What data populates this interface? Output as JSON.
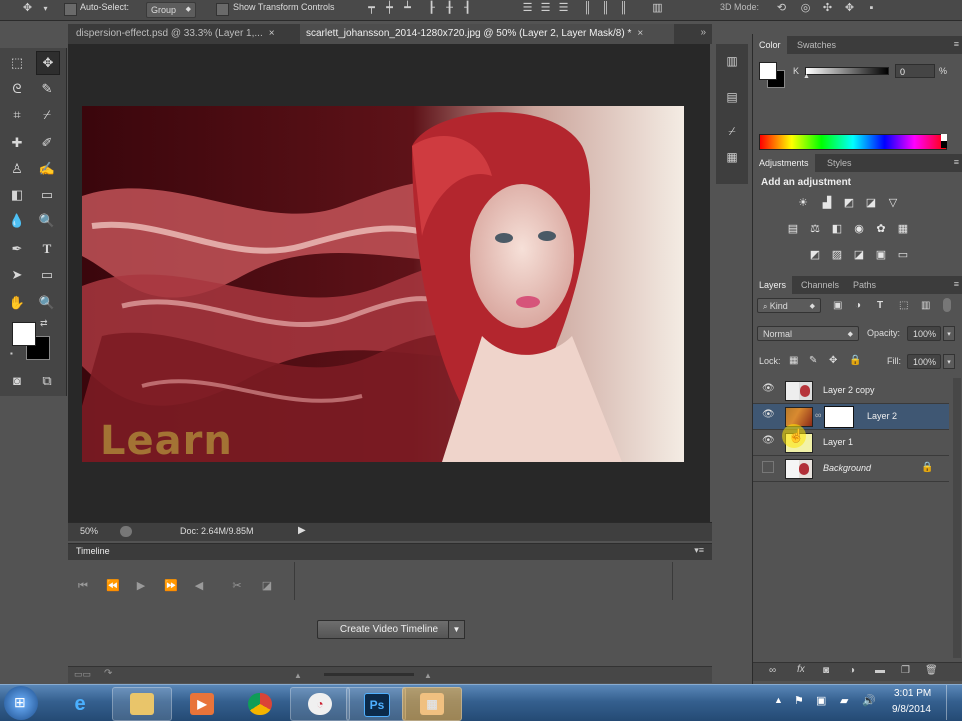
{
  "options_bar": {
    "auto_select_label": "Auto-Select:",
    "auto_select_value": "Group",
    "show_transform_label": "Show Transform Controls",
    "mode_3d_label": "3D Mode:"
  },
  "document_tabs": [
    {
      "label": "dispersion-effect.psd @ 33.3% (Layer 1,...",
      "close": "×"
    },
    {
      "label": "scarlett_johansson_2014-1280x720.jpg @ 50% (Layer 2, Layer Mask/8) *",
      "close": "×"
    }
  ],
  "watermark": "Learn",
  "status": {
    "zoom": "50%",
    "doc": "Doc: 2.64M/9.85M"
  },
  "timeline": {
    "title": "Timeline",
    "create_button": "Create Video Timeline"
  },
  "color_panel": {
    "tabs": [
      "Color",
      "Swatches"
    ],
    "k_label": "K",
    "k_value": "0",
    "k_unit": "%"
  },
  "adjustments_panel": {
    "tabs": [
      "Adjustments",
      "Styles"
    ],
    "heading": "Add an adjustment",
    "row1_icons": [
      "brightness-contrast-icon",
      "levels-icon",
      "curves-icon",
      "exposure-icon",
      "vibrance-icon"
    ],
    "row2_icons": [
      "hue-saturation-icon",
      "color-balance-icon",
      "black-white-icon",
      "photo-filter-icon",
      "channel-mixer-icon",
      "color-lookup-icon"
    ],
    "row3_icons": [
      "invert-icon",
      "posterize-icon",
      "threshold-icon",
      "selective-color-icon",
      "gradient-map-icon"
    ]
  },
  "layers_panel": {
    "tabs": [
      "Layers",
      "Channels",
      "Paths"
    ],
    "filter_kind": "Kind",
    "blend_mode": "Normal",
    "opacity_label": "Opacity:",
    "opacity_value": "100%",
    "lock_label": "Lock:",
    "fill_label": "Fill:",
    "fill_value": "100%",
    "layers": [
      {
        "name": "Layer 2 copy",
        "visible": true,
        "selected": false
      },
      {
        "name": "Layer 2",
        "visible": true,
        "selected": true
      },
      {
        "name": "Layer 1",
        "visible": true,
        "selected": false
      },
      {
        "name": "Background",
        "visible": false,
        "selected": false
      }
    ]
  },
  "taskbar": {
    "time": "3:01 PM",
    "date": "9/8/2014",
    "ps_label": "Ps"
  },
  "colors": {
    "selected_layer": "#3f5773",
    "taskbar": "#35608f",
    "app_bg": "#535353"
  }
}
